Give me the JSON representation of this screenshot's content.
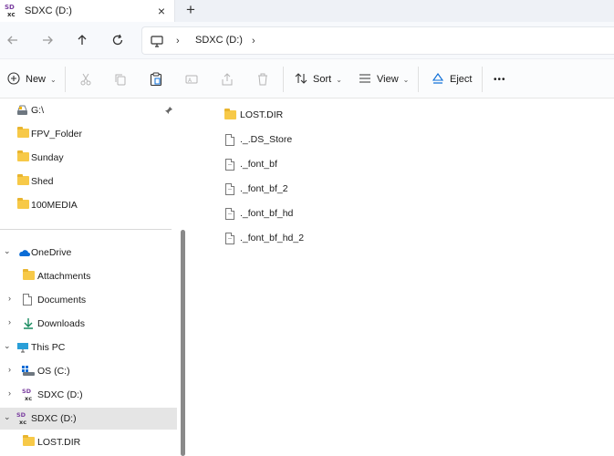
{
  "tab": {
    "title": "SDXC (D:)",
    "close": "×",
    "new": "+"
  },
  "address": {
    "segment": "SDXC (D:)",
    "chevron": "›"
  },
  "toolbar": {
    "new_label": "New",
    "sort_label": "Sort",
    "view_label": "View",
    "eject_label": "Eject",
    "more": "•••",
    "caret": "⌄"
  },
  "sidebar": {
    "quick_access": [
      "G:\\",
      "FPV_Folder",
      "Sunday",
      "Shed",
      "100MEDIA"
    ],
    "onedrive": "OneDrive",
    "attachments": "Attachments",
    "documents": "Documents",
    "downloads": "Downloads",
    "this_pc": "This PC",
    "os": "OS (C:)",
    "sdxc_child": "SDXC (D:)",
    "sdxc_root": "SDXC (D:)",
    "lost_dir": "LOST.DIR",
    "chev_right": "›",
    "chev_down": "⌄"
  },
  "files": [
    {
      "name": "LOST.DIR",
      "icon": "folder-icon"
    },
    {
      "name": "._.DS_Store",
      "icon": "file-icon"
    },
    {
      "name": "._font_bf",
      "icon": "file-icon"
    },
    {
      "name": "._font_bf_2",
      "icon": "file-icon"
    },
    {
      "name": "._font_bf_hd",
      "icon": "file-icon"
    },
    {
      "name": "._font_bf_hd_2",
      "icon": "file-icon"
    }
  ],
  "colors": {
    "folder": "#f7c948",
    "onedrive": "#0a6cd6",
    "selected": "#e5e5e5",
    "sd_logo_purple": "#7b3fa0"
  }
}
